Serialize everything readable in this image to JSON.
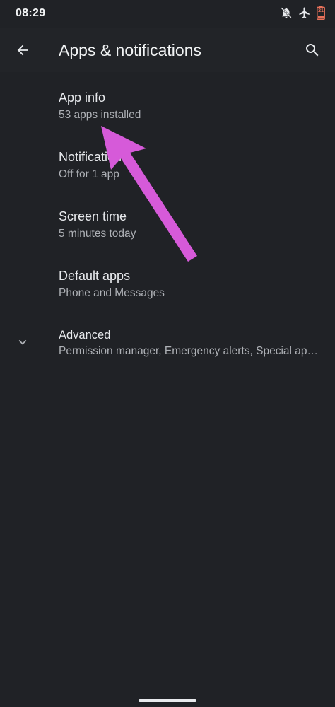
{
  "status_bar": {
    "time": "08:29",
    "icons": [
      "notifications-off-icon",
      "airplane-mode-icon",
      "battery-icon"
    ],
    "battery_level": "21",
    "battery_color": "#e8715a"
  },
  "app_bar": {
    "title": "Apps & notifications",
    "back_icon": "back-arrow-icon",
    "search_icon": "search-icon"
  },
  "settings": {
    "items": [
      {
        "title": "App info",
        "summary": "53 apps installed"
      },
      {
        "title": "Notifications",
        "summary": "Off for 1 app"
      },
      {
        "title": "Screen time",
        "summary": "5 minutes today"
      },
      {
        "title": "Default apps",
        "summary": "Phone and Messages"
      },
      {
        "title": "Advanced",
        "summary": "Permission manager, Emergency alerts, Special app access",
        "icon": "chevron-down-icon"
      }
    ]
  },
  "annotation": {
    "icon": "pointer-arrow-icon",
    "color": "#d65ad9"
  },
  "colors": {
    "background": "#202226",
    "title_text": "#e8eaed",
    "summary_text": "#aeb1b6"
  }
}
